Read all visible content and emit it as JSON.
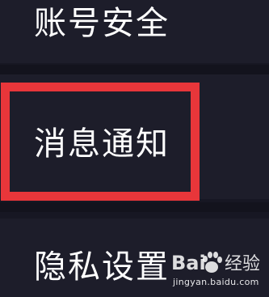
{
  "menu": {
    "items": [
      {
        "label": "账号安全"
      },
      {
        "label": "消息通知"
      },
      {
        "label": "隐私设置"
      }
    ],
    "highlighted_item": "消息通知"
  },
  "watermark": {
    "brand_text": "Baidu经验",
    "url": "jingyan.baidu.com",
    "icon": "baidu-paw-icon"
  },
  "colors": {
    "background": "#171723",
    "text": "#ffffff",
    "highlight_border": "#e8363a"
  }
}
